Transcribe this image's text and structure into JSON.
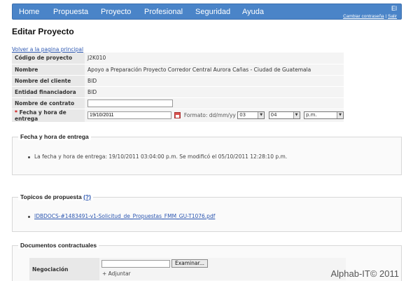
{
  "nav": {
    "items": [
      "Home",
      "Propuesta",
      "Proyecto",
      "Profesional",
      "Seguridad",
      "Ayuda"
    ],
    "user": "El",
    "change_password": "Cambiar contraseña",
    "separator": "|",
    "logout": "Salir"
  },
  "page": {
    "title": "Editar Proyecto",
    "back_link": "Volver a la pagina principal"
  },
  "form": {
    "rows": [
      {
        "label": "Código de proyecto",
        "value": "J2K010"
      },
      {
        "label": "Nombre",
        "value": "Apoyo a Preparación Proyecto Corredor Central Aurora Cañas - Ciudad de Guatemala"
      },
      {
        "label": "Nombre del cliente",
        "value": "BID"
      },
      {
        "label": "Entidad financiadora",
        "value": "BID"
      }
    ],
    "contract_label": "Nombre de contrato",
    "contract_value": "",
    "required_mark": "*",
    "date_label": "Fecha y hora de entrega",
    "date_value": "19/10/2011",
    "format_text": "Formato: dd/mm/yy",
    "hour": "03",
    "minute": "04",
    "ampm": "p.m."
  },
  "delivery": {
    "legend": "Fecha y hora de entrega",
    "line": "La fecha y hora de entrega: 19/10/2011 03:04:00 p.m. Se modificó el 05/10/2011 12:28:10 p.m."
  },
  "topics": {
    "legend": "Topicos de propuesta",
    "help": "(?)",
    "file": "IDBDOCS-#1483491-v1-Solicitud_de_Propuestas_FMM_GU-T1076.pdf"
  },
  "docs": {
    "legend": "Documentos contractuales",
    "row_label": "Negociación",
    "browse": "Examinar...",
    "attach": "+ Adjuntar"
  },
  "watermark": "Alphab-IT© 2011"
}
